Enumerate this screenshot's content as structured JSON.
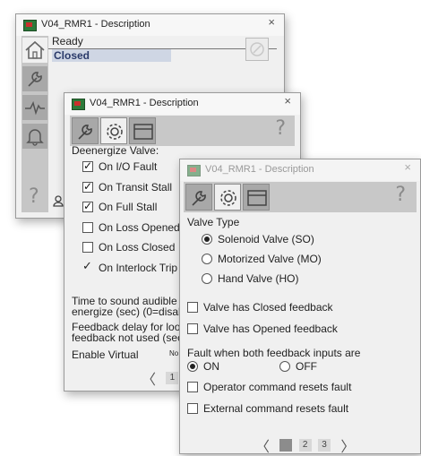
{
  "win1": {
    "title": "V04_RMR1 - Description",
    "status": "Ready",
    "state": "Closed",
    "close_glyph": "×",
    "help_glyph": "?"
  },
  "win2": {
    "title": "V04_RMR1 - Description",
    "close_glyph": "×",
    "help_glyph": "?",
    "section_label": "Deenergize Valve:",
    "items": [
      {
        "label": "On I/O Fault",
        "checked": true
      },
      {
        "label": "On Transit Stall",
        "checked": true
      },
      {
        "label": "On Full Stall",
        "checked": true
      },
      {
        "label": "On Loss Opened",
        "checked": false
      },
      {
        "label": "On Loss Closed",
        "checked": false
      },
      {
        "label": "On Interlock Trip",
        "checked": true
      }
    ],
    "audible_text_1": "Time to sound audible on co",
    "audible_text_2": "energize (sec) (0=disabled)",
    "feedback_text_1": "Feedback delay for loopback",
    "feedback_text_2": "feedback not used (sec)",
    "enable_virtual": "Enable Virtual",
    "enable_virtual_value": "No",
    "pager": {
      "prev": "〈",
      "page1": "1"
    }
  },
  "win3": {
    "title": "V04_RMR1 - Description",
    "close_glyph": "×",
    "help_glyph": "?",
    "valve_type_label": "Valve Type",
    "valve_types": [
      {
        "label": "Solenoid Valve (SO)",
        "selected": true
      },
      {
        "label": "Motorized Valve (MO)",
        "selected": false
      },
      {
        "label": "Hand Valve (HO)",
        "selected": false
      }
    ],
    "closed_feedback": "Valve has Closed feedback",
    "opened_feedback": "Valve has Opened feedback",
    "fault_label": "Fault when both feedback inputs are",
    "fault_on": "ON",
    "fault_off": "OFF",
    "operator_reset": "Operator command resets fault",
    "external_reset": "External command resets fault",
    "pager": {
      "prev": "〈",
      "next": "〉",
      "pages": [
        "1",
        "2",
        "3"
      ]
    }
  },
  "icons": {
    "home": "home-icon",
    "wrench": "wrench-icon",
    "trend": "trend-icon",
    "alarm": "bell-icon",
    "gear": "gear-icon",
    "faceplate": "faceplate-icon",
    "user": "user-icon",
    "reset": "reset-icon"
  }
}
